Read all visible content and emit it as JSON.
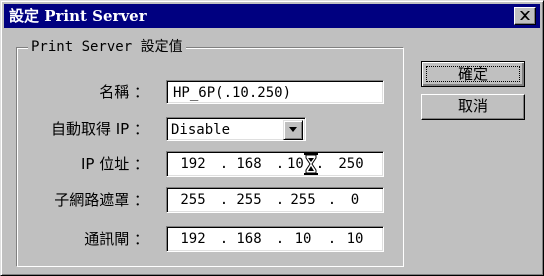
{
  "window": {
    "title": "設定 Print Server"
  },
  "group": {
    "label": "Print Server 設定值"
  },
  "fields": {
    "name": {
      "label": "名稱 ：",
      "value": "HP_6P(.10.250)"
    },
    "auto_ip": {
      "label": "自動取得 IP ：",
      "value": "Disable"
    },
    "ip": {
      "label": "IP 位址 ：",
      "octets": [
        "192",
        "168",
        "10",
        "250"
      ]
    },
    "subnet": {
      "label": "子網路遮罩 ：",
      "octets": [
        "255",
        "255",
        "255",
        "0"
      ]
    },
    "gateway": {
      "label": "通訊閘 ：",
      "octets": [
        "192",
        "168",
        "10",
        "10"
      ]
    }
  },
  "buttons": {
    "ok": "確定",
    "cancel": "取消"
  },
  "icons": {
    "close": "close-icon",
    "dropdown": "chevron-down-icon",
    "cursor": "hourglass-icon"
  }
}
